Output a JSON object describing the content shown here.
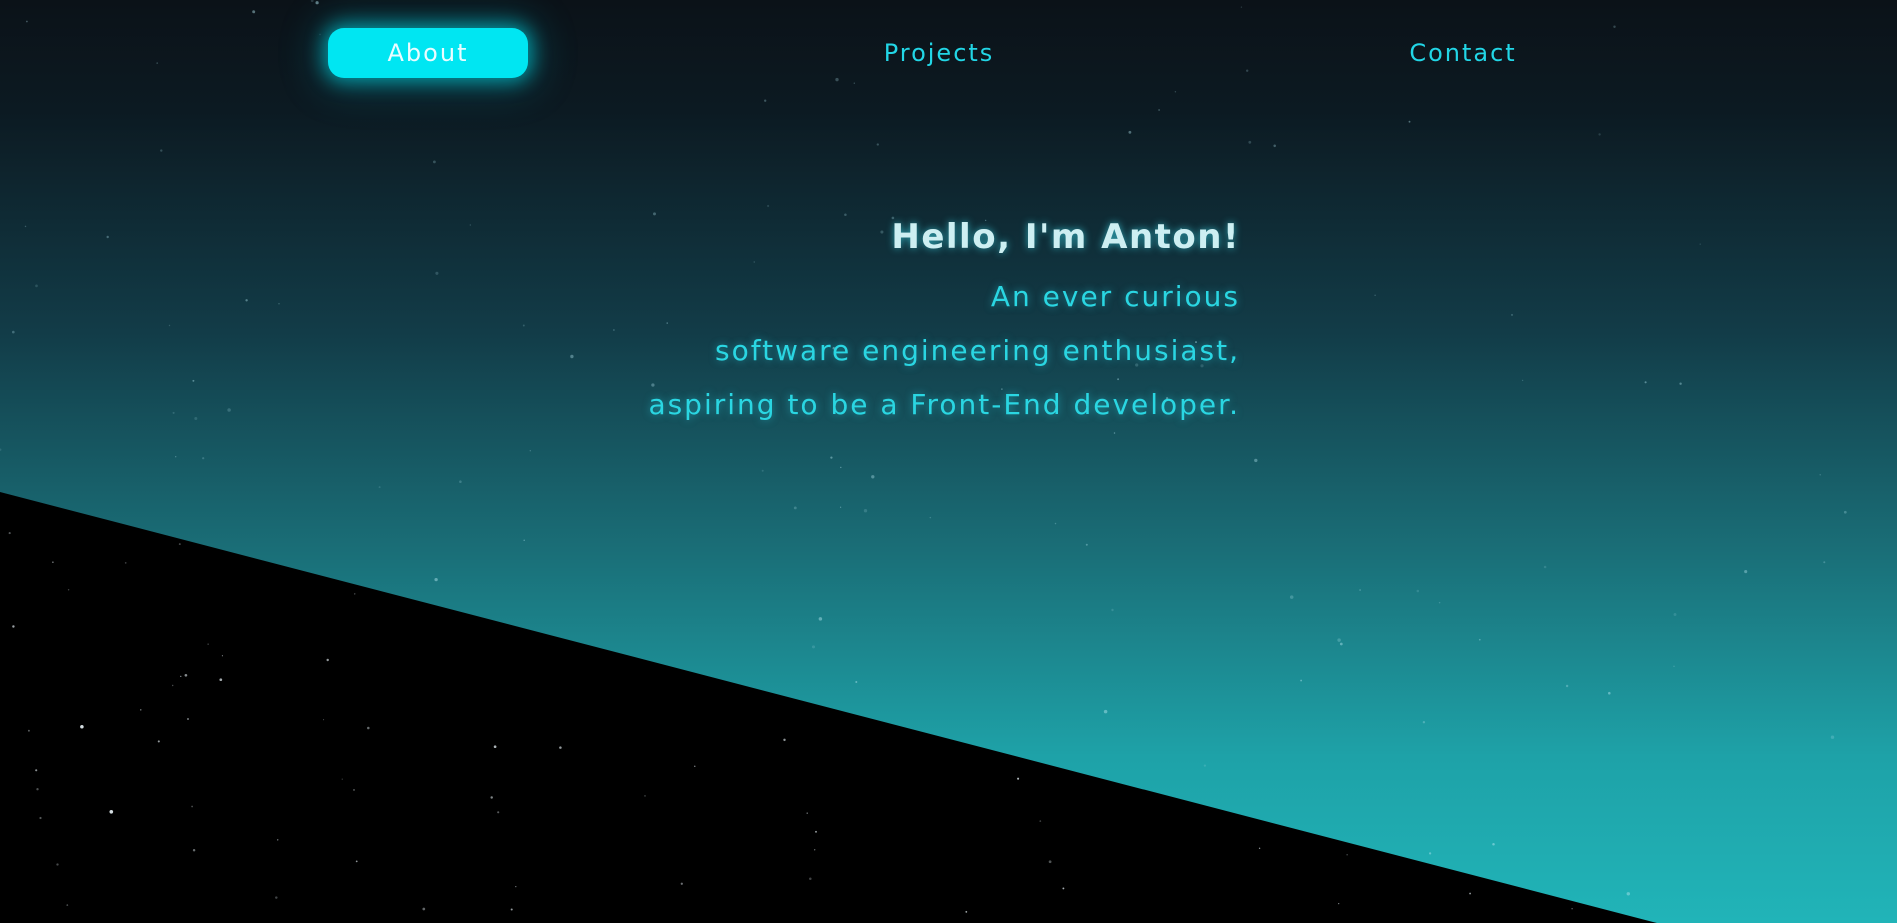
{
  "nav": {
    "items": [
      {
        "label": "About",
        "active": true
      },
      {
        "label": "Projects",
        "active": false
      },
      {
        "label": "Contact",
        "active": false
      }
    ]
  },
  "intro": {
    "heading": "Hello, I'm Anton!",
    "lines": [
      "An ever curious",
      "software engineering enthusiast,",
      "aspiring to be a Front-End developer."
    ]
  },
  "colors": {
    "accent": "#00e6f2",
    "nav_text": "#22d6e6",
    "heading": "#cdeff2",
    "body_text": "#2ad6e2",
    "sky_top": "#0b1218",
    "sky_bottom": "#21b4b8",
    "ground": "#000000"
  }
}
